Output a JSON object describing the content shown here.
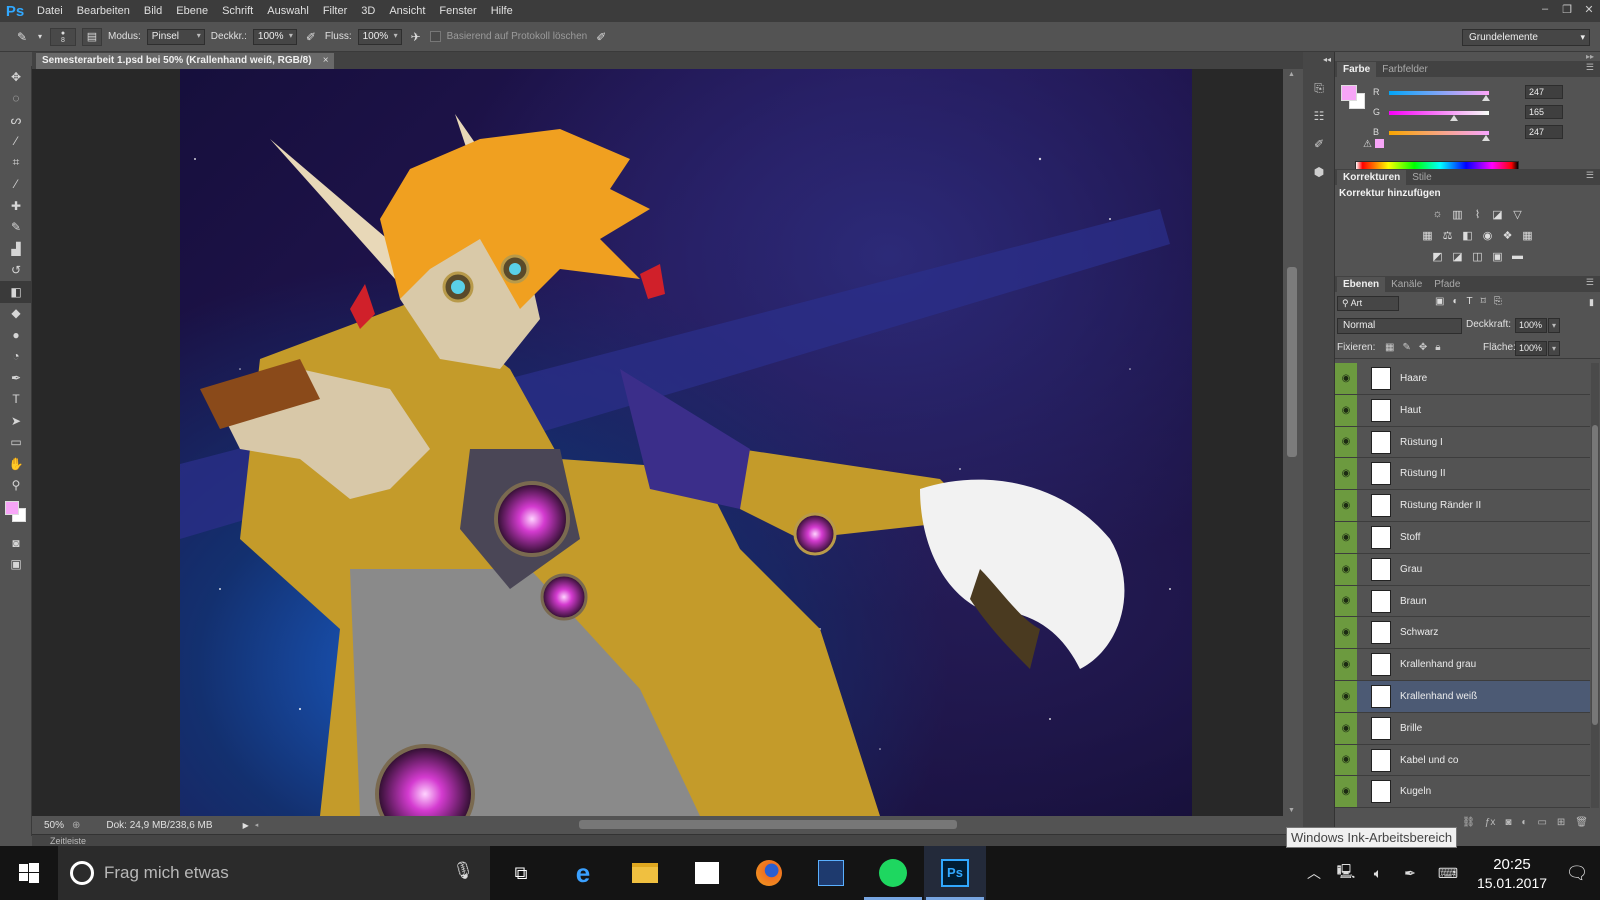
{
  "app": {
    "logo": "Ps",
    "menus": [
      "Datei",
      "Bearbeiten",
      "Bild",
      "Ebene",
      "Schrift",
      "Auswahl",
      "Filter",
      "3D",
      "Ansicht",
      "Fenster",
      "Hilfe"
    ],
    "window_controls": [
      "–",
      "❐",
      "✕"
    ]
  },
  "options": {
    "brush_size": "8",
    "mode_label": "Modus:",
    "mode_value": "Pinsel",
    "opacity_label": "Deckkr.:",
    "opacity_value": "100%",
    "flow_label": "Fluss:",
    "flow_value": "100%",
    "history_label": "Basierend auf Protokoll löschen",
    "workspace": "Grundelemente"
  },
  "document": {
    "tab_title": "Semesterarbeit 1.psd bei 50% (Krallenhand weiß, RGB/8)",
    "tab_close": "×",
    "zoom": "50%",
    "doc_info": "Dok: 24,9 MB/238,6 MB",
    "timeline_label": "Zeitleiste"
  },
  "colors": {
    "foreground": "#f7a5f7",
    "accent_green": "#6c9a3f",
    "selected_row": "#4c5a74"
  },
  "color_panel": {
    "tabs": [
      "Farbe",
      "Farbfelder"
    ],
    "channels": [
      {
        "label": "R",
        "value": "247",
        "fraction": 0.969
      },
      {
        "label": "G",
        "value": "165",
        "fraction": 0.647
      },
      {
        "label": "B",
        "value": "247",
        "fraction": 0.969
      }
    ]
  },
  "adjust_panel": {
    "tabs": [
      "Korrekturen",
      "Stile"
    ],
    "title": "Korrektur hinzufügen"
  },
  "layers_panel": {
    "tabs": [
      "Ebenen",
      "Kanäle",
      "Pfade"
    ],
    "filter": "Art",
    "blend_mode": "Normal",
    "opacity_label": "Deckkraft:",
    "opacity_value": "100%",
    "lock_label": "Fixieren:",
    "fill_label": "Fläche:",
    "fill_value": "100%",
    "layers": [
      {
        "name": "Haare",
        "selected": false
      },
      {
        "name": "Haut",
        "selected": false
      },
      {
        "name": "Rüstung I",
        "selected": false
      },
      {
        "name": "Rüstung II",
        "selected": false
      },
      {
        "name": "Rüstung Ränder II",
        "selected": false
      },
      {
        "name": "Stoff",
        "selected": false
      },
      {
        "name": "Grau",
        "selected": false
      },
      {
        "name": "Braun",
        "selected": false
      },
      {
        "name": "Schwarz",
        "selected": false
      },
      {
        "name": "Krallenhand grau",
        "selected": false
      },
      {
        "name": "Krallenhand weiß",
        "selected": true
      },
      {
        "name": "Brille",
        "selected": false
      },
      {
        "name": "Kabel und co",
        "selected": false
      },
      {
        "name": "Kugeln",
        "selected": false
      }
    ]
  },
  "tooltip": "Windows Ink-Arbeitsbereich",
  "taskbar": {
    "search_placeholder": "Frag mich etwas",
    "time": "20:25",
    "date": "15.01.2017"
  }
}
